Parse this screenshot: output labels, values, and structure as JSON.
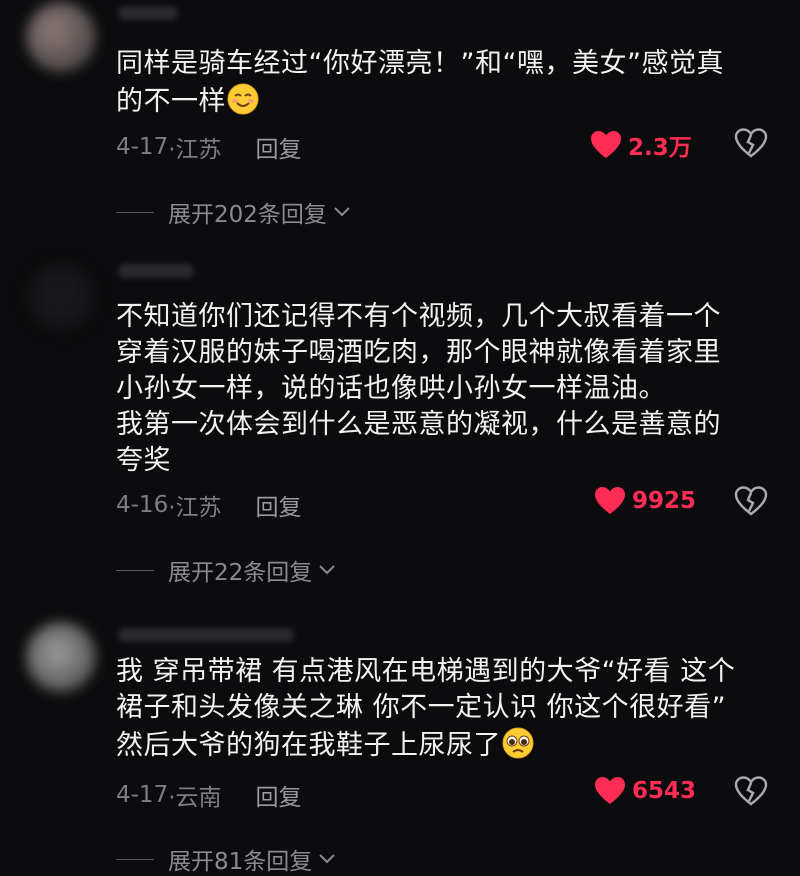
{
  "colors": {
    "like": "#ff2c55",
    "muted": "#7d7d82",
    "background": "#0c0c0e"
  },
  "comments": [
    {
      "text": "同样是骑车经过“你好漂亮！”和“嘿，美女”感觉真\n的不一样",
      "emoji": "smiling-face-icon",
      "date": "4-17",
      "location": "·江苏",
      "reply": "回复",
      "likes": "2.3万",
      "expand": "展开202条回复"
    },
    {
      "text": "不知道你们还记得不有个视频，几个大叔看着一个\n穿着汉服的妹子喝酒吃肉，那个眼神就像看着家里\n小孙女一样，说的话也像哄小孙女一样温油。\n我第一次体会到什么是恶意的凝视，什么是善意的\n夸奖",
      "date": "4-16",
      "location": "·江苏",
      "reply": "回复",
      "likes": "9925",
      "expand": "展开22条回复"
    },
    {
      "text": "我 穿吊带裙 有点港风在电梯遇到的大爷“好看 这个\n裙子和头发像关之琳 你不一定认识 你这个很好看”\n然后大爷的狗在我鞋子上尿尿了",
      "emoji": "pleading-face-icon",
      "date": "4-17",
      "location": "·云南",
      "reply": "回复",
      "likes": "6543",
      "expand": "展开81条回复"
    }
  ]
}
